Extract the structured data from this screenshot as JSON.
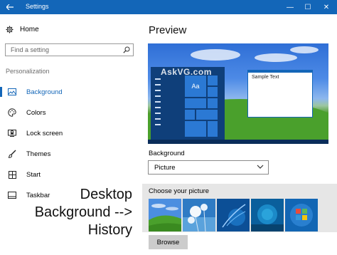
{
  "window": {
    "title": "Settings",
    "controls": {
      "minimize": "—",
      "maximize": "☐",
      "close": "✕"
    }
  },
  "sidebar": {
    "home_label": "Home",
    "search_placeholder": "Find a setting",
    "section_label": "Personalization",
    "items": [
      {
        "label": "Background",
        "icon": "picture-icon",
        "active": true
      },
      {
        "label": "Colors",
        "icon": "palette-icon",
        "active": false
      },
      {
        "label": "Lock screen",
        "icon": "lock-screen-icon",
        "active": false
      },
      {
        "label": "Themes",
        "icon": "brush-icon",
        "active": false
      },
      {
        "label": "Start",
        "icon": "start-icon",
        "active": false
      },
      {
        "label": "Taskbar",
        "icon": "taskbar-icon",
        "active": false
      }
    ]
  },
  "annotation": {
    "line1": "Desktop",
    "line2": "Background -->",
    "line3": "History"
  },
  "main": {
    "title": "Preview",
    "preview": {
      "watermark": "AskVG.com",
      "tile_label": "Aa",
      "window_text": "Sample Text"
    },
    "background_label": "Background",
    "background_value": "Picture",
    "choose_label": "Choose your picture",
    "thumbnails": [
      {
        "name": "bliss-hill"
      },
      {
        "name": "dandelion"
      },
      {
        "name": "blue-flower-glow"
      },
      {
        "name": "blue-abstract"
      },
      {
        "name": "windows-7-logo"
      }
    ],
    "browse_label": "Browse"
  },
  "colors": {
    "accent": "#1366b8",
    "titlebar": "#1366b8",
    "picker_bg": "#e6e6e6"
  }
}
